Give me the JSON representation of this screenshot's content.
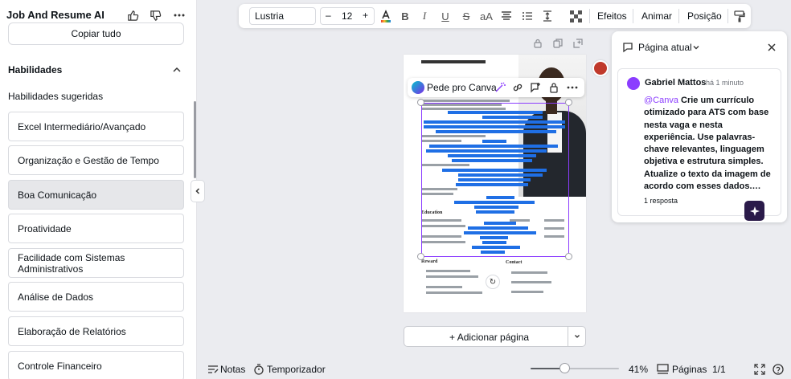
{
  "left_panel": {
    "title": "Job And Resume AI",
    "copy_all_label": "Copiar tudo",
    "section_title": "Habilidades",
    "suggested_title": "Habilidades sugeridas",
    "skills": [
      {
        "label": "Excel Intermediário/Avançado",
        "selected": false
      },
      {
        "label": "Organização e Gestão de Tempo",
        "selected": false
      },
      {
        "label": "Boa Comunicação",
        "selected": true
      },
      {
        "label": "Proatividade",
        "selected": false
      },
      {
        "label": "Facilidade com Sistemas Administrativos",
        "selected": false
      },
      {
        "label": "Análise de Dados",
        "selected": false
      },
      {
        "label": "Elaboração de Relatórios",
        "selected": false
      },
      {
        "label": "Controle Financeiro",
        "selected": false
      }
    ]
  },
  "toolbar": {
    "font": "Lustria",
    "font_size": "12",
    "minus": "–",
    "plus": "+",
    "text_color": "#e53935",
    "effects": "Efeitos",
    "animate": "Animar",
    "position": "Posição"
  },
  "canvas": {
    "context_bar_label": "Pede pro Canva",
    "document": {
      "education_heading": "Education",
      "reward_heading": "Reward",
      "contact_heading": "Contact"
    },
    "add_page_label": "Adicionar página",
    "add_page_plus": "+"
  },
  "comment_panel": {
    "title": "Página atual",
    "author": "Gabriel Mattos",
    "time": "há 1 minuto",
    "mention": "@Canva",
    "text": "Crie um currículo otimizado para ATS com base nesta vaga e nesta experiência. Use palavras-chave relevantes, linguagem objetiva e estrutura simples. Atualize o texto da imagem de acordo com esses dados.…",
    "replies": "1 resposta"
  },
  "bottom_bar": {
    "notes": "Notas",
    "timer": "Temporizador",
    "zoom": "41%",
    "zoom_fraction": 0.38,
    "pages": "Páginas",
    "page_count": "1/1"
  },
  "icons": {
    "accent": "#8b3dff",
    "highlight": "#1f6fe5"
  }
}
